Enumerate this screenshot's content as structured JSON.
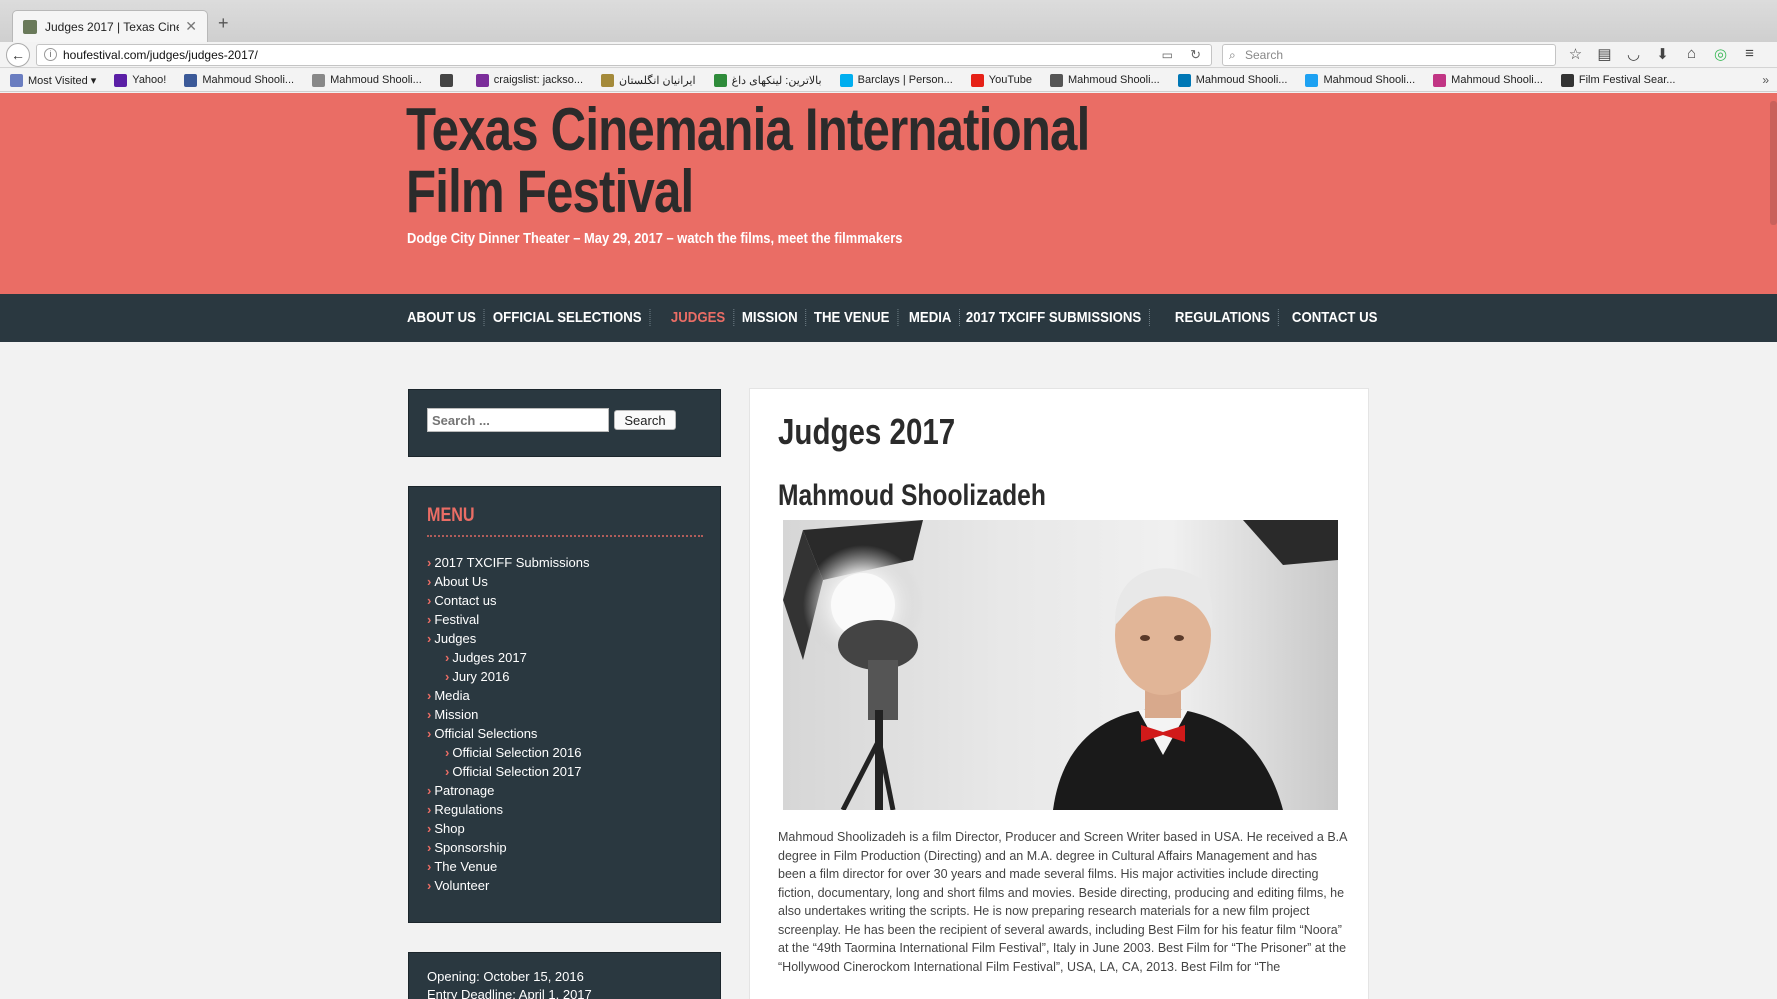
{
  "browser": {
    "tab_title": "Judges 2017 | Texas Cine...",
    "url": "houfestival.com/judges/judges-2017/",
    "search_placeholder": "Search",
    "bookmarks": [
      {
        "label": "Most Visited ▾",
        "color": "#6a7dc0"
      },
      {
        "label": "Yahoo!",
        "color": "#5b1fa6"
      },
      {
        "label": "Mahmoud Shooli...",
        "color": "#3b5998"
      },
      {
        "label": "Mahmoud Shooli...",
        "color": "#888888"
      },
      {
        "label": "",
        "color": "#444444"
      },
      {
        "label": "craigslist: jackso...",
        "color": "#7b2d9a"
      },
      {
        "label": "ایرانیان انگلستان",
        "color": "#a48a3a"
      },
      {
        "label": "بالاترین: لینکهای داغ",
        "color": "#2e8b3a"
      },
      {
        "label": "Barclays | Person...",
        "color": "#00aeef"
      },
      {
        "label": "YouTube",
        "color": "#e62117"
      },
      {
        "label": "Mahmoud Shooli...",
        "color": "#555555"
      },
      {
        "label": "Mahmoud Shooli...",
        "color": "#0077b5"
      },
      {
        "label": "Mahmoud Shooli...",
        "color": "#1da1f2"
      },
      {
        "label": "Mahmoud Shooli...",
        "color": "#c13584"
      },
      {
        "label": "Film Festival Sear...",
        "color": "#333333"
      }
    ]
  },
  "header": {
    "site_title": "Texas Cinemania International Film Festival",
    "tagline": "Dodge City Dinner Theater – May 29, 2017 – watch the films, meet the filmmakers",
    "accent": "#ea6d65",
    "nav_bg": "#2a3840"
  },
  "nav": [
    {
      "label": "About Us",
      "active": false
    },
    {
      "label": "Official Selections",
      "active": false
    },
    {
      "label": "Judges",
      "active": true
    },
    {
      "label": "Mission",
      "active": false
    },
    {
      "label": "The Venue",
      "active": false
    },
    {
      "label": "Media",
      "active": false
    },
    {
      "label": "2017 TXCIFF Submissions",
      "active": false
    },
    {
      "label": "Regulations",
      "active": false
    },
    {
      "label": "Contact Us",
      "active": false
    }
  ],
  "sidebar": {
    "search_placeholder": "Search ...",
    "search_button": "Search",
    "menu_title": "MENU",
    "menu": [
      {
        "label": "2017 TXCIFF Submissions",
        "sub": false
      },
      {
        "label": "About Us",
        "sub": false
      },
      {
        "label": "Contact us",
        "sub": false
      },
      {
        "label": "Festival",
        "sub": false
      },
      {
        "label": "Judges",
        "sub": false
      },
      {
        "label": "Judges 2017",
        "sub": true
      },
      {
        "label": "Jury 2016",
        "sub": true
      },
      {
        "label": "Media",
        "sub": false
      },
      {
        "label": "Mission",
        "sub": false
      },
      {
        "label": "Official Selections",
        "sub": false
      },
      {
        "label": "Official Selection 2016",
        "sub": true
      },
      {
        "label": "Official Selection 2017",
        "sub": true
      },
      {
        "label": "Patronage",
        "sub": false
      },
      {
        "label": "Regulations",
        "sub": false
      },
      {
        "label": "Shop",
        "sub": false
      },
      {
        "label": "Sponsorship",
        "sub": false
      },
      {
        "label": "The Venue",
        "sub": false
      },
      {
        "label": "Volunteer",
        "sub": false
      }
    ],
    "dates": {
      "opening": "Opening: October 15, 2016",
      "deadline": "Entry Deadline: April 1, 2017"
    }
  },
  "content": {
    "page_title": "Judges 2017",
    "judge_name": "Mahmoud Shoolizadeh",
    "bio": "Mahmoud Shoolizadeh is a film Director, Producer and Screen Writer based in USA. He received a B.A degree in Film Production (Directing) and an M.A. degree in Cultural Affairs Management and has been a film director for over 30 years and made several films. His major activities include directing fiction, documentary, long and short films and movies. Beside directing, producing and editing films, he also undertakes writing the scripts. He is now preparing research materials for a new film project screenplay. He has been the recipient of several awards, including Best Film for his featur film “Noora” at the “49th Taormina International Film Festival”, Italy in June 2003. Best Film for “The Prisoner” at the “Hollywood Cinerockom International Film Festival”, USA, LA, CA, 2013. Best Film for “The"
  }
}
